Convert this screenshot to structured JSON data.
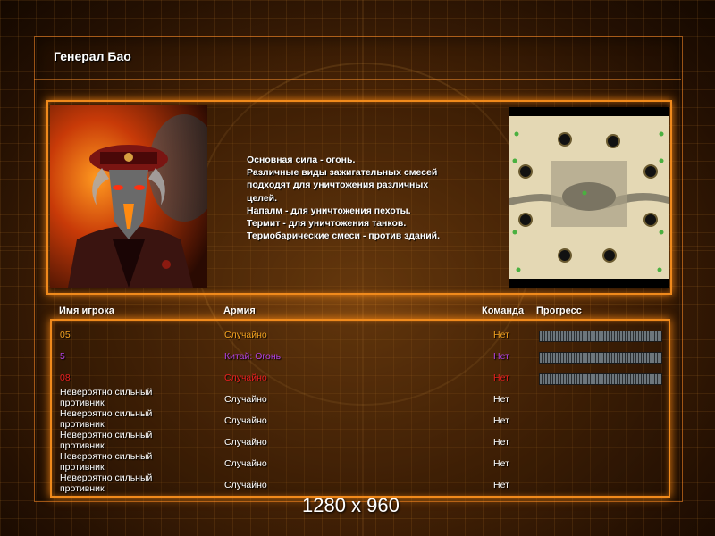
{
  "window": {
    "title": "Генерал Бао"
  },
  "general": {
    "description": "Основная сила - огонь.\nРазличные виды зажигательных смесей\n подходят для уничтожения различных\n целей.\nНапалм - для уничтожения пехоты.\nТермит - для уничтожения танков.\nТермобарические смеси - против зданий."
  },
  "columns": {
    "player": "Имя игрока",
    "army": "Армия",
    "team": "Команда",
    "progress": "Прогресс"
  },
  "players": [
    {
      "name": "05",
      "army": "Случайно",
      "team": "Нет",
      "color": "#f0a020",
      "progress": true
    },
    {
      "name": "5",
      "army": "Китай: Огонь",
      "team": "Нет",
      "color": "#b040e0",
      "progress": true
    },
    {
      "name": "08",
      "army": "Случайно",
      "team": "Нет",
      "color": "#e82020",
      "progress": true
    },
    {
      "name": "Невероятно сильный\n противник",
      "army": "Случайно",
      "team": "Нет",
      "color": "#ffffff",
      "progress": false
    },
    {
      "name": "Невероятно сильный\n противник",
      "army": "Случайно",
      "team": "Нет",
      "color": "#ffffff",
      "progress": false
    },
    {
      "name": "Невероятно сильный\n противник",
      "army": "Случайно",
      "team": "Нет",
      "color": "#ffffff",
      "progress": false
    },
    {
      "name": "Невероятно сильный\n противник",
      "army": "Случайно",
      "team": "Нет",
      "color": "#ffffff",
      "progress": false
    },
    {
      "name": "Невероятно сильный\n противник",
      "army": "Случайно",
      "team": "Нет",
      "color": "#ffffff",
      "progress": false
    }
  ],
  "watermark": "1280 x 960",
  "colors": {
    "accent": "#f08a1c"
  }
}
